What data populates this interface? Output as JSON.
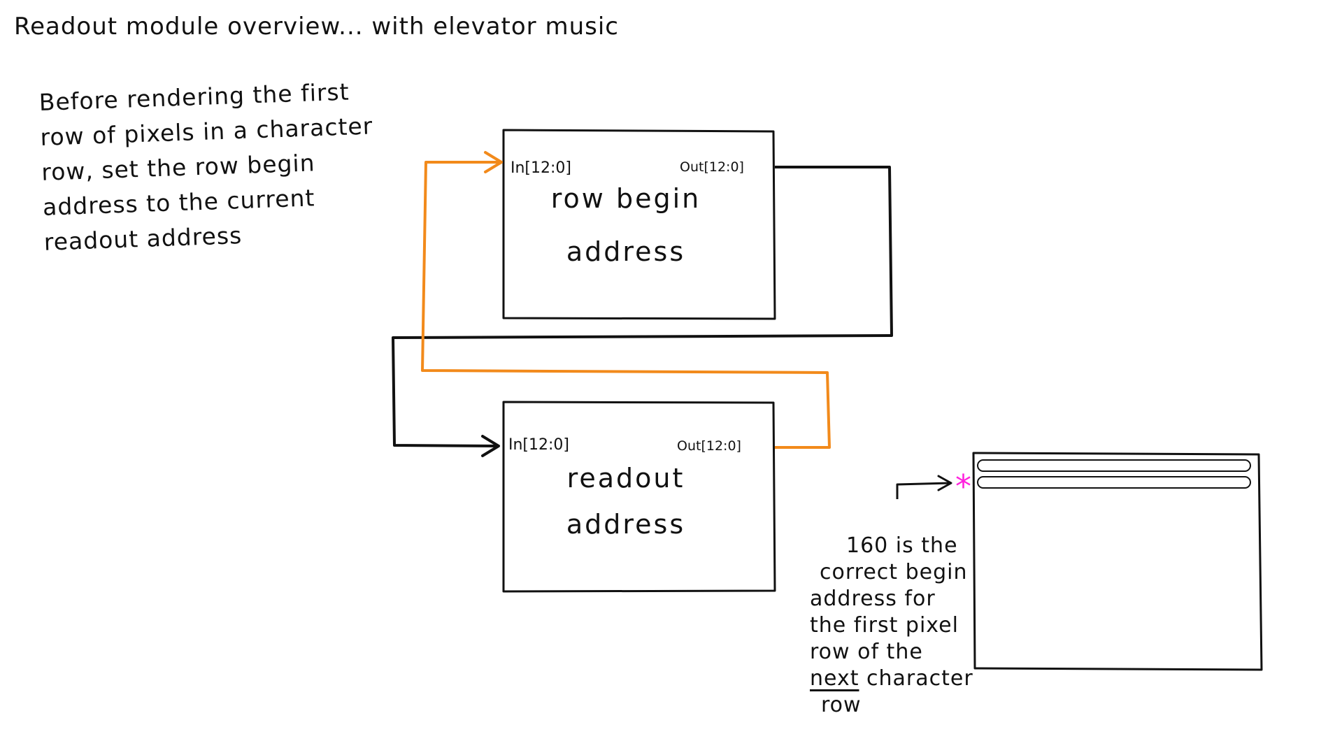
{
  "title": "Readout module overview... with elevator music",
  "note": {
    "lines": [
      "Before rendering the first",
      "row of pixels in a character",
      "row, set the row begin",
      "address to the current",
      "readout address"
    ]
  },
  "row_begin_box": {
    "in_port": "In[12:0]",
    "out_port": "Out[12:0]",
    "label_line1": "row begin",
    "label_line2": "address"
  },
  "readout_box": {
    "in_port": "In[12:0]",
    "out_port": "Out[12:0]",
    "label_line1": "readout",
    "label_line2": "address"
  },
  "callout": {
    "line1": "160 is the",
    "line2": "correct begin",
    "line3": "address for",
    "line4": "the first pixel",
    "line5": "row of the",
    "line6_emph": "next",
    "line6_rest": " character",
    "line7": "row"
  },
  "marker_symbol": "*",
  "colors": {
    "ink": "#111111",
    "feedback_wire": "#f28a1b",
    "marker": "#ff22dd"
  }
}
